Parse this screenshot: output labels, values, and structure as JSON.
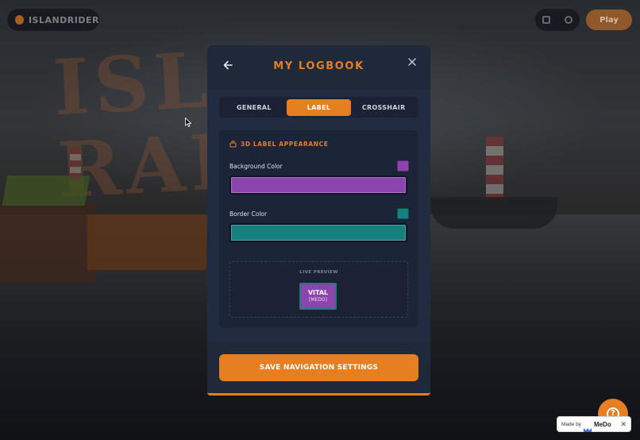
{
  "app": {
    "brand": "ISLANDRIDER",
    "top_cta": "Play"
  },
  "modal": {
    "title": "MY LOGBOOK",
    "tabs": [
      {
        "label": "GENERAL",
        "active": false
      },
      {
        "label": "LABEL",
        "active": true
      },
      {
        "label": "CROSSHAIR",
        "active": false
      }
    ],
    "section": {
      "heading": "3D LABEL APPEARANCE",
      "icon": "tag-icon",
      "background_color": {
        "label": "Background Color",
        "value": "#8e44ad"
      },
      "border_color": {
        "label": "Border Color",
        "value": "#16807f"
      },
      "preview": {
        "label": "LIVE PREVIEW",
        "name": "VITAL",
        "sub": "[MEDO]"
      }
    },
    "save_label": "SAVE NAVIGATION SETTINGS"
  },
  "widgets": {
    "help_icon": "help-icon",
    "madeby_text": "Made by",
    "madeby_brand": "MeDo",
    "madeby_close": "✕"
  },
  "colors": {
    "accent": "#e67e22",
    "modal_bg": "#222c40",
    "panel_bg": "#1c2537"
  }
}
